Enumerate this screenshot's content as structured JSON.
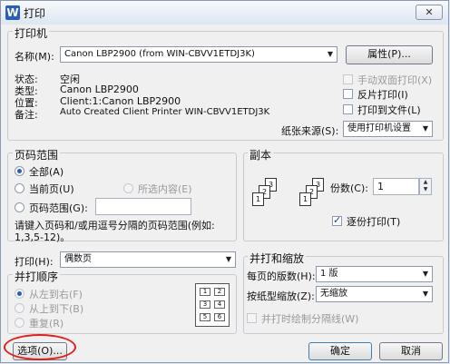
{
  "window": {
    "title": "打印",
    "close_glyph": "✕"
  },
  "printer": {
    "group_label": "打印机",
    "name_label": "名称(M):",
    "name_value": "Canon LBP2900 (from WIN-CBVV1ETDJ3K)",
    "properties_button": "属性(P)...",
    "status_label": "状态:",
    "status_value": "空闲",
    "type_label": "类型:",
    "type_value": "Canon LBP2900",
    "location_label": "位置:",
    "location_value": "Client:1:Canon LBP2900",
    "comment_label": "备注:",
    "comment_value": "Auto Created Client Printer WIN-CBVV1ETDJ3K",
    "duplex_label": "手动双面打印(X)",
    "reverse_label": "反片打印(I)",
    "to_file_label": "打印到文件(L)",
    "paper_source_label": "纸张来源(S):",
    "paper_source_value": "使用打印机设置"
  },
  "page_range": {
    "group_label": "页码范围",
    "all_label": "全部(A)",
    "current_label": "当前页(U)",
    "selection_label": "所选内容(E)",
    "pages_label": "页码范围(G):",
    "hint": "请键入页码和/或用逗号分隔的页码范围(例如:",
    "hint_example": "1,3,5-12)。"
  },
  "copies": {
    "group_label": "副本",
    "count_label": "份数(C):",
    "count_value": "1",
    "collate_label": "逐份打印(T)"
  },
  "print_what": {
    "label": "打印(H):",
    "value": "偶数页"
  },
  "order": {
    "group_label": "并打顺序",
    "left_right": "从左到右(F)",
    "top_bottom": "从上到下(B)",
    "repeat": "重复(R)",
    "grid": [
      "1",
      "2",
      "3",
      "4",
      "5",
      "6"
    ]
  },
  "zoom": {
    "group_label": "并打和缩放",
    "pages_per_sheet_label": "每页的版数(H):",
    "pages_per_sheet_value": "1 版",
    "scale_label": "按纸型缩放(Z):",
    "scale_value": "无缩放",
    "divider_label": "并打时绘制分隔线(W)"
  },
  "footer": {
    "options_button": "选项(O)...",
    "ok_button": "确定",
    "cancel_button": "取消"
  },
  "colors": {
    "highlight_circle": "#e0201d",
    "accent": "#2a5dc0"
  }
}
